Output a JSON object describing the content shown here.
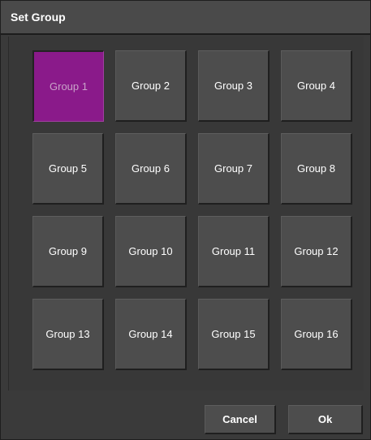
{
  "dialog": {
    "title": "Set Group",
    "selected_group": "Group 1",
    "groups": [
      {
        "label": "Group 1"
      },
      {
        "label": "Group 2"
      },
      {
        "label": "Group 3"
      },
      {
        "label": "Group 4"
      },
      {
        "label": "Group 5"
      },
      {
        "label": "Group 6"
      },
      {
        "label": "Group 7"
      },
      {
        "label": "Group 8"
      },
      {
        "label": "Group 9"
      },
      {
        "label": "Group 10"
      },
      {
        "label": "Group 11"
      },
      {
        "label": "Group 12"
      },
      {
        "label": "Group 13"
      },
      {
        "label": "Group 14"
      },
      {
        "label": "Group 15"
      },
      {
        "label": "Group 16"
      }
    ],
    "cancel_label": "Cancel",
    "ok_label": "Ok"
  },
  "colors": {
    "background": "#3a3a3a",
    "button": "#4d4d4d",
    "selected_accent": "#8a1a8a",
    "text": "#ffffff"
  }
}
